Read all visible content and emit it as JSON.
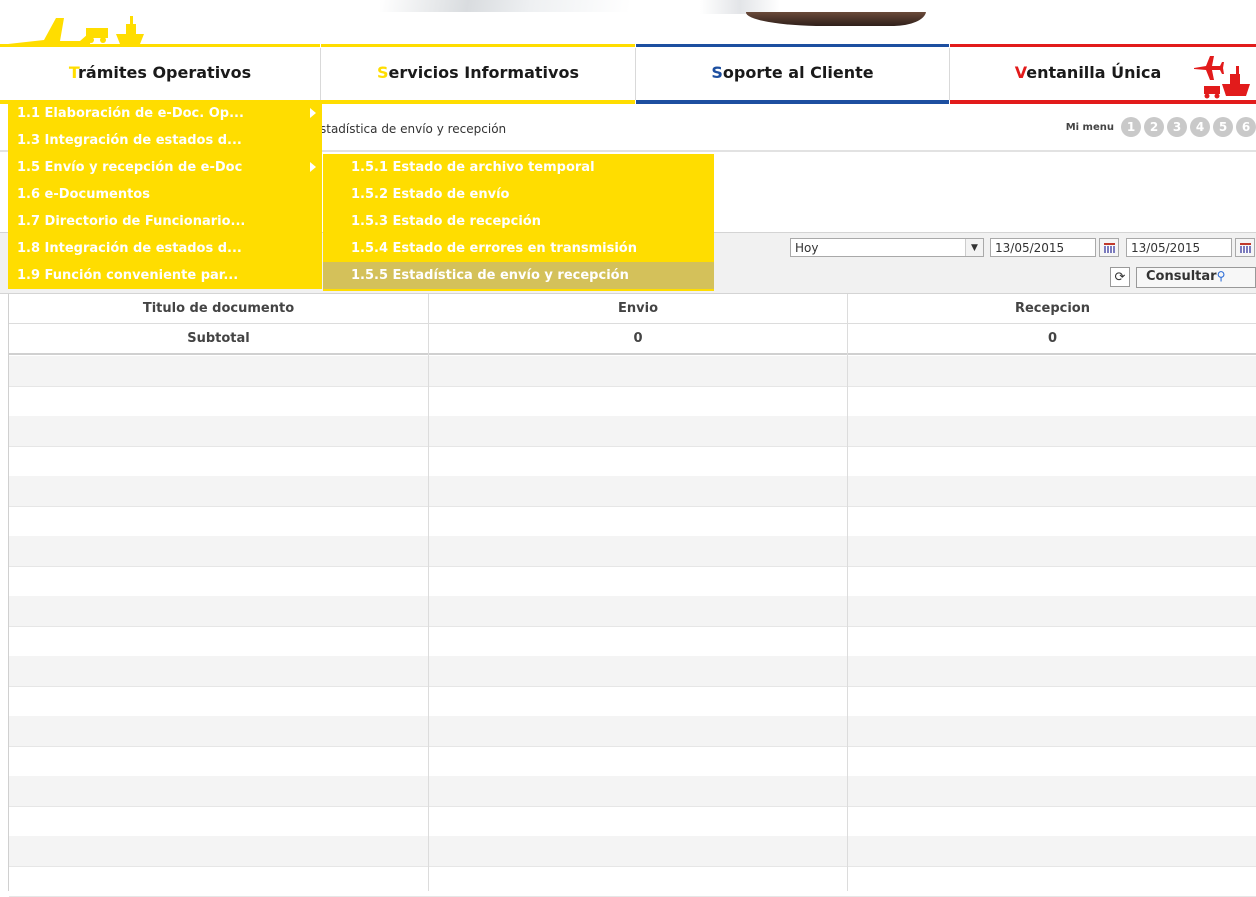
{
  "colors": {
    "yellow": "#ffdd00",
    "blue": "#1d4fa0",
    "red": "#e21b1b",
    "menu_active": "#d4c15a"
  },
  "nav": {
    "items": [
      {
        "first": "T",
        "rest": "rámites Operativos",
        "accent": "#ffdd00"
      },
      {
        "first": "S",
        "rest": "ervicios Informativos",
        "accent": "#ffdd00"
      },
      {
        "first": "S",
        "rest": "oporte al Cliente",
        "accent": "#1d4fa0"
      },
      {
        "first": "V",
        "rest": "entanilla Única",
        "accent": "#e21b1b"
      }
    ]
  },
  "breadcrumb": "stadística de envío y recepción",
  "mymenu": {
    "label": "Mi menu",
    "numbers": [
      "1",
      "2",
      "3",
      "4",
      "5",
      "6"
    ]
  },
  "filter": {
    "period_value": "Hoy",
    "date_from": "13/05/2015",
    "date_to": "13/05/2015"
  },
  "actions": {
    "consultar": "Consultar"
  },
  "menu_level1": [
    {
      "label": "1.1 Elaboración de e-Doc. Op...",
      "has_sub": true
    },
    {
      "label": "1.3 Integración de estados d...",
      "has_sub": false
    },
    {
      "label": "1.5 Envío y recepción de e-Doc",
      "has_sub": true
    },
    {
      "label": "1.6 e-Documentos",
      "has_sub": false
    },
    {
      "label": "1.7 Directorio de Funcionario...",
      "has_sub": false
    },
    {
      "label": "1.8 Integración de estados d...",
      "has_sub": false
    },
    {
      "label": "1.9 Función conveniente par...",
      "has_sub": false
    }
  ],
  "menu_level2": [
    {
      "label": "1.5.1 Estado de archivo temporal",
      "active": false
    },
    {
      "label": "1.5.2 Estado de envío",
      "active": false
    },
    {
      "label": "1.5.3 Estado de recepción",
      "active": false
    },
    {
      "label": "1.5.4 Estado de errores en transmisión",
      "active": false
    },
    {
      "label": "1.5.5 Estadística de envío y recepción",
      "active": true
    }
  ],
  "table": {
    "headers": [
      "Titulo de documento",
      "Envio",
      "Recepcion"
    ],
    "subtotal": [
      "Subtotal",
      "0",
      "0"
    ],
    "empty_rows": 18
  }
}
